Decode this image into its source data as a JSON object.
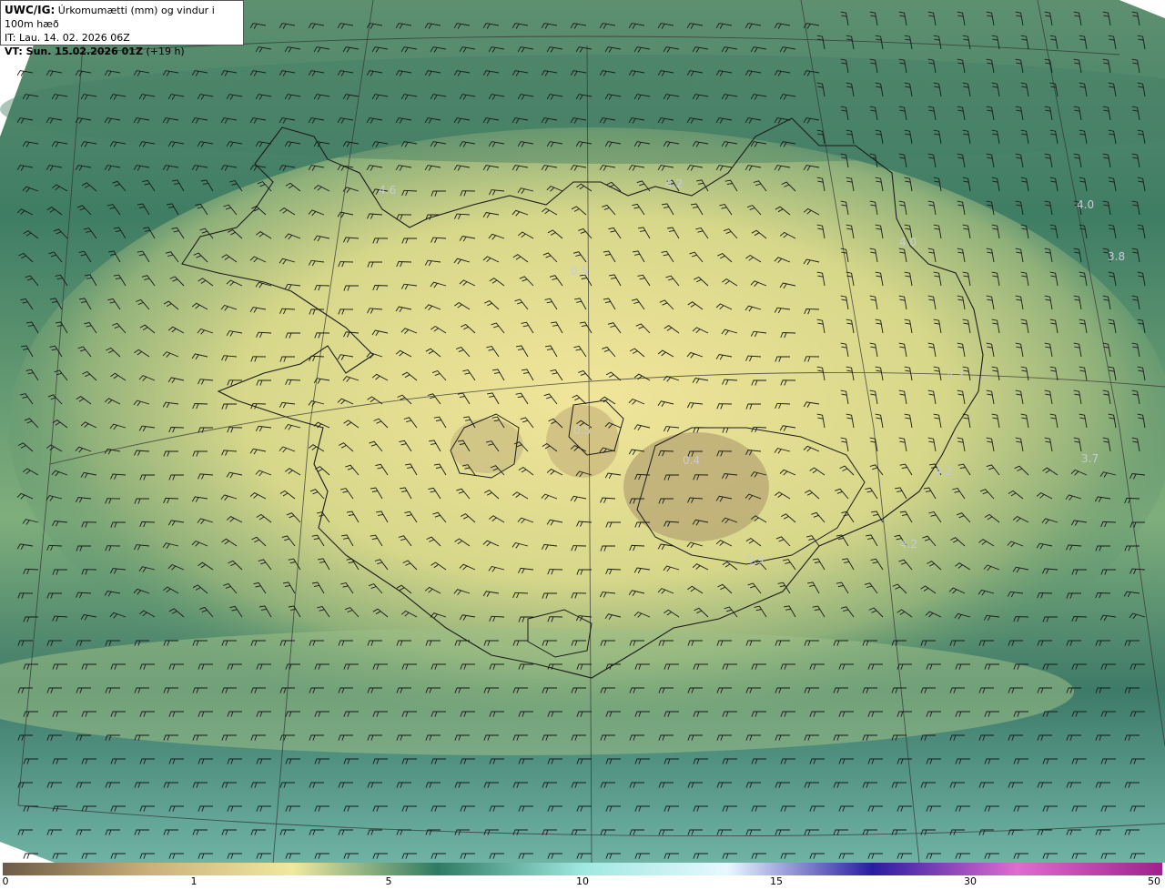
{
  "header": {
    "title_bold": "UWC/IG:",
    "title_rest": "Úrkomumætti (mm) og vindur i 100m hæð",
    "it_line": "IT: Lau. 14. 02. 2026 06Z",
    "vt_bold": "VT: Sun. 15.02.2026 01Z",
    "vt_rest": "(+19 h)"
  },
  "map_values": [
    {
      "id": "v1",
      "text": "4.6"
    },
    {
      "id": "v2",
      "text": "4.2"
    },
    {
      "id": "v3",
      "text": "4.0"
    },
    {
      "id": "v4",
      "text": "4.0"
    },
    {
      "id": "v5",
      "text": "3.8"
    },
    {
      "id": "v6",
      "text": "4.3"
    },
    {
      "id": "v7",
      "text": "3.7"
    },
    {
      "id": "v8",
      "text": "4.2"
    },
    {
      "id": "v9",
      "text": "4.2"
    },
    {
      "id": "v10",
      "text": "0.4"
    },
    {
      "id": "v11",
      "text": "0.5"
    },
    {
      "id": "v12",
      "text": "0.5"
    },
    {
      "id": "v13",
      "text": "0.9"
    }
  ],
  "colorbar": {
    "ticks": [
      "0",
      "1",
      "5",
      "10",
      "15",
      "30",
      "50"
    ],
    "colors": [
      "#6b5a47",
      "#c9b07a",
      "#f0e9a0",
      "#2f7a63",
      "#9fe8e0",
      "#e8f8ff",
      "#2a1ca0",
      "#e06cd0",
      "#a0208c"
    ]
  }
}
